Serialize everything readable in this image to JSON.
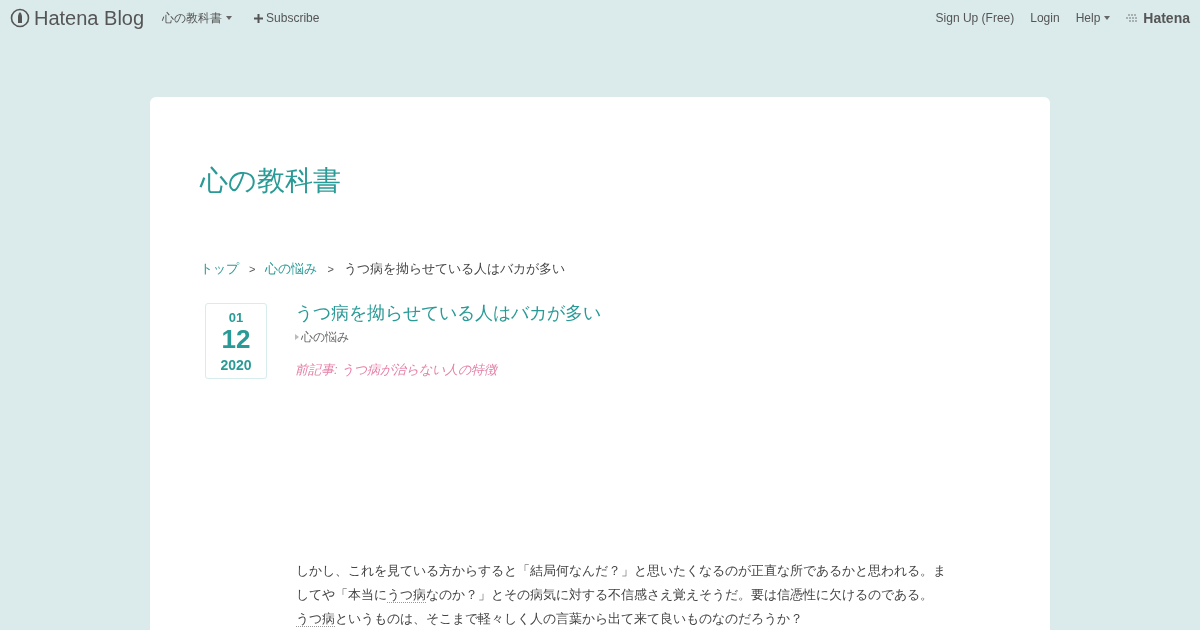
{
  "topbar": {
    "logo": "Hatena Blog",
    "blog_menu": "心の教科書",
    "subscribe": "Subscribe",
    "links": [
      "Sign Up (Free)",
      "Login"
    ],
    "help": "Help",
    "brand": "Hatena"
  },
  "blog": {
    "title": "心の教科書"
  },
  "breadcrumb_separator": ">",
  "breadcrumb": [
    {
      "label": "トップ",
      "kind": "link"
    },
    {
      "label": "心の悩み",
      "kind": "link"
    },
    {
      "label": "うつ病を拗らせている人はバカが多い",
      "kind": "current"
    }
  ],
  "article": {
    "date": {
      "month": "01",
      "day": "12",
      "year": "2020"
    },
    "title": "うつ病を拗らせている人はバカが多い",
    "category": "心の悩み",
    "previous": "前記事: うつ病が治らない人の特徴",
    "paragraph": [
      {
        "kind": "text",
        "text": "しかし、これを見ている方からすると「結局何なんだ？」と思いたくなるのが正直な所であるかと思われる。ましてや「本当に"
      },
      {
        "kind": "link",
        "text": "うつ病"
      },
      {
        "kind": "text",
        "text": "なのか？」とその病気に対する不信感さえ覚えそうだ。要は信憑性に欠けるのである。"
      },
      {
        "kind": "link",
        "text": "うつ病"
      },
      {
        "kind": "text",
        "text": "というものは、そこまで軽々しく人の言葉から出て来て良いものなのだろうか？"
      }
    ]
  }
}
